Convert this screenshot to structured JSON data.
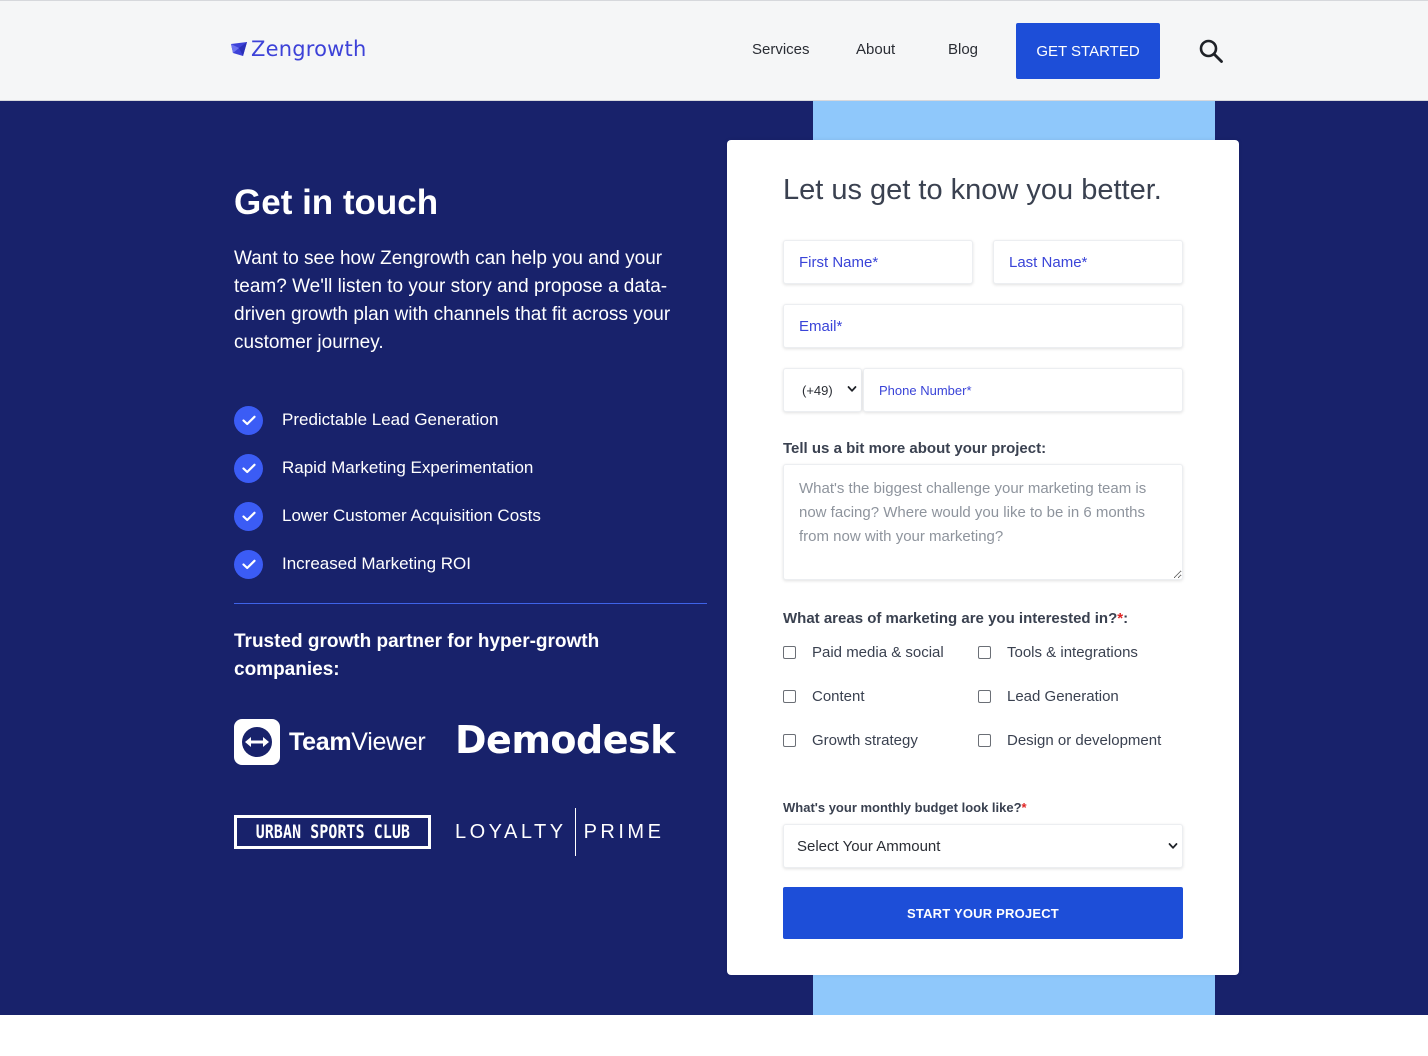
{
  "header": {
    "logo_text": "Zengrowth",
    "nav": [
      {
        "label": "Services"
      },
      {
        "label": "About"
      },
      {
        "label": "Blog"
      }
    ],
    "cta_label": "GET STARTED",
    "search_icon": "search-icon"
  },
  "hero": {
    "title": "Get in touch",
    "intro": "Want to see how Zengrowth can help you and your team? We'll listen to your story and propose a data-driven growth plan with channels that fit across your customer journey.",
    "benefits": [
      {
        "label": "Predictable Lead Generation"
      },
      {
        "label": "Rapid Marketing Experimentation"
      },
      {
        "label": "Lower Customer Acquisition Costs"
      },
      {
        "label": "Increased Marketing ROI"
      }
    ],
    "partners_title": "Trusted growth partner for hyper-growth companies:",
    "partners": {
      "teamviewer_bold": "Team",
      "teamviewer_light": "Viewer",
      "demodesk": "Demodesk",
      "urban_sports_club": "URBAN SPORTS CLUB",
      "loyalty": "LOYALTY",
      "prime": "PRIME"
    }
  },
  "form": {
    "title": "Let us get to know you better.",
    "first_name_placeholder": "First Name*",
    "last_name_placeholder": "Last Name*",
    "email_placeholder": "Email*",
    "country_code": "(+49)",
    "phone_placeholder": "Phone Number*",
    "project_label": "Tell us a bit more about your project:",
    "project_placeholder": "What's the biggest challenge your marketing team is now facing? Where would you like to be in 6 months from now with your marketing?",
    "areas_label": "What areas of marketing are you interested in?",
    "required_mark": "*",
    "areas_colon": ":",
    "areas": [
      {
        "label": "Paid media & social"
      },
      {
        "label": "Tools & integrations"
      },
      {
        "label": "Content"
      },
      {
        "label": "Lead Generation"
      },
      {
        "label": "Growth strategy"
      },
      {
        "label": "Design or development"
      }
    ],
    "budget_label": "What's your monthly budget look like?",
    "budget_selected": "Select Your Ammount",
    "submit_label": "START YOUR PROJECT"
  },
  "colors": {
    "brand_blue": "#1d4ed8",
    "hero_navy": "#18226b",
    "accent_light_blue": "#8fc8fb",
    "check_blue": "#3b5cf5"
  }
}
